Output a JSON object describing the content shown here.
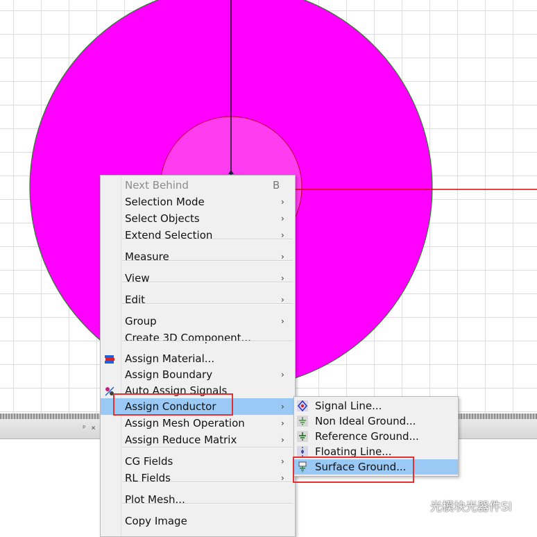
{
  "context_menu": {
    "items": [
      {
        "label": "Next Behind",
        "shortcut": "B",
        "disabled": true
      },
      {
        "label": "Selection Mode",
        "submenu": true
      },
      {
        "label": "Select Objects",
        "submenu": true
      },
      {
        "label": "Extend Selection",
        "submenu": true
      },
      {
        "label": "Measure",
        "submenu": true
      },
      {
        "label": "View",
        "submenu": true
      },
      {
        "label": "Edit",
        "submenu": true
      },
      {
        "label": "Group",
        "submenu": true
      },
      {
        "label": "Create 3D Component..."
      },
      {
        "label": "Assign Material...",
        "icon": "material-icon"
      },
      {
        "label": "Assign Boundary",
        "submenu": true
      },
      {
        "label": "Auto Assign Signals",
        "icon": "auto-assign-icon"
      },
      {
        "label": "Assign Conductor",
        "submenu": true,
        "highlighted": true
      },
      {
        "label": "Assign Mesh Operation",
        "submenu": true
      },
      {
        "label": "Assign Reduce Matrix",
        "submenu": true
      },
      {
        "label": "CG Fields",
        "submenu": true
      },
      {
        "label": "RL Fields",
        "submenu": true
      },
      {
        "label": "Plot Mesh..."
      },
      {
        "label": "Copy Image"
      }
    ],
    "arrow_glyph": "›"
  },
  "conductor_submenu": {
    "items": [
      {
        "label": "Signal Line...",
        "icon": "signal-line-icon"
      },
      {
        "label": "Non Ideal Ground...",
        "icon": "non-ideal-ground-icon"
      },
      {
        "label": "Reference Ground...",
        "icon": "reference-ground-icon"
      },
      {
        "label": "Floating Line...",
        "icon": "floating-line-icon"
      },
      {
        "label": "Surface Ground...",
        "icon": "surface-ground-icon",
        "highlighted": true
      }
    ]
  },
  "watermark": {
    "text": "光模块光器件SI"
  },
  "colors": {
    "shape_fill": "#ff00ff",
    "axis_red": "#e00000",
    "menu_highlight": "#99c9f4",
    "annotation_box": "#e53030"
  }
}
